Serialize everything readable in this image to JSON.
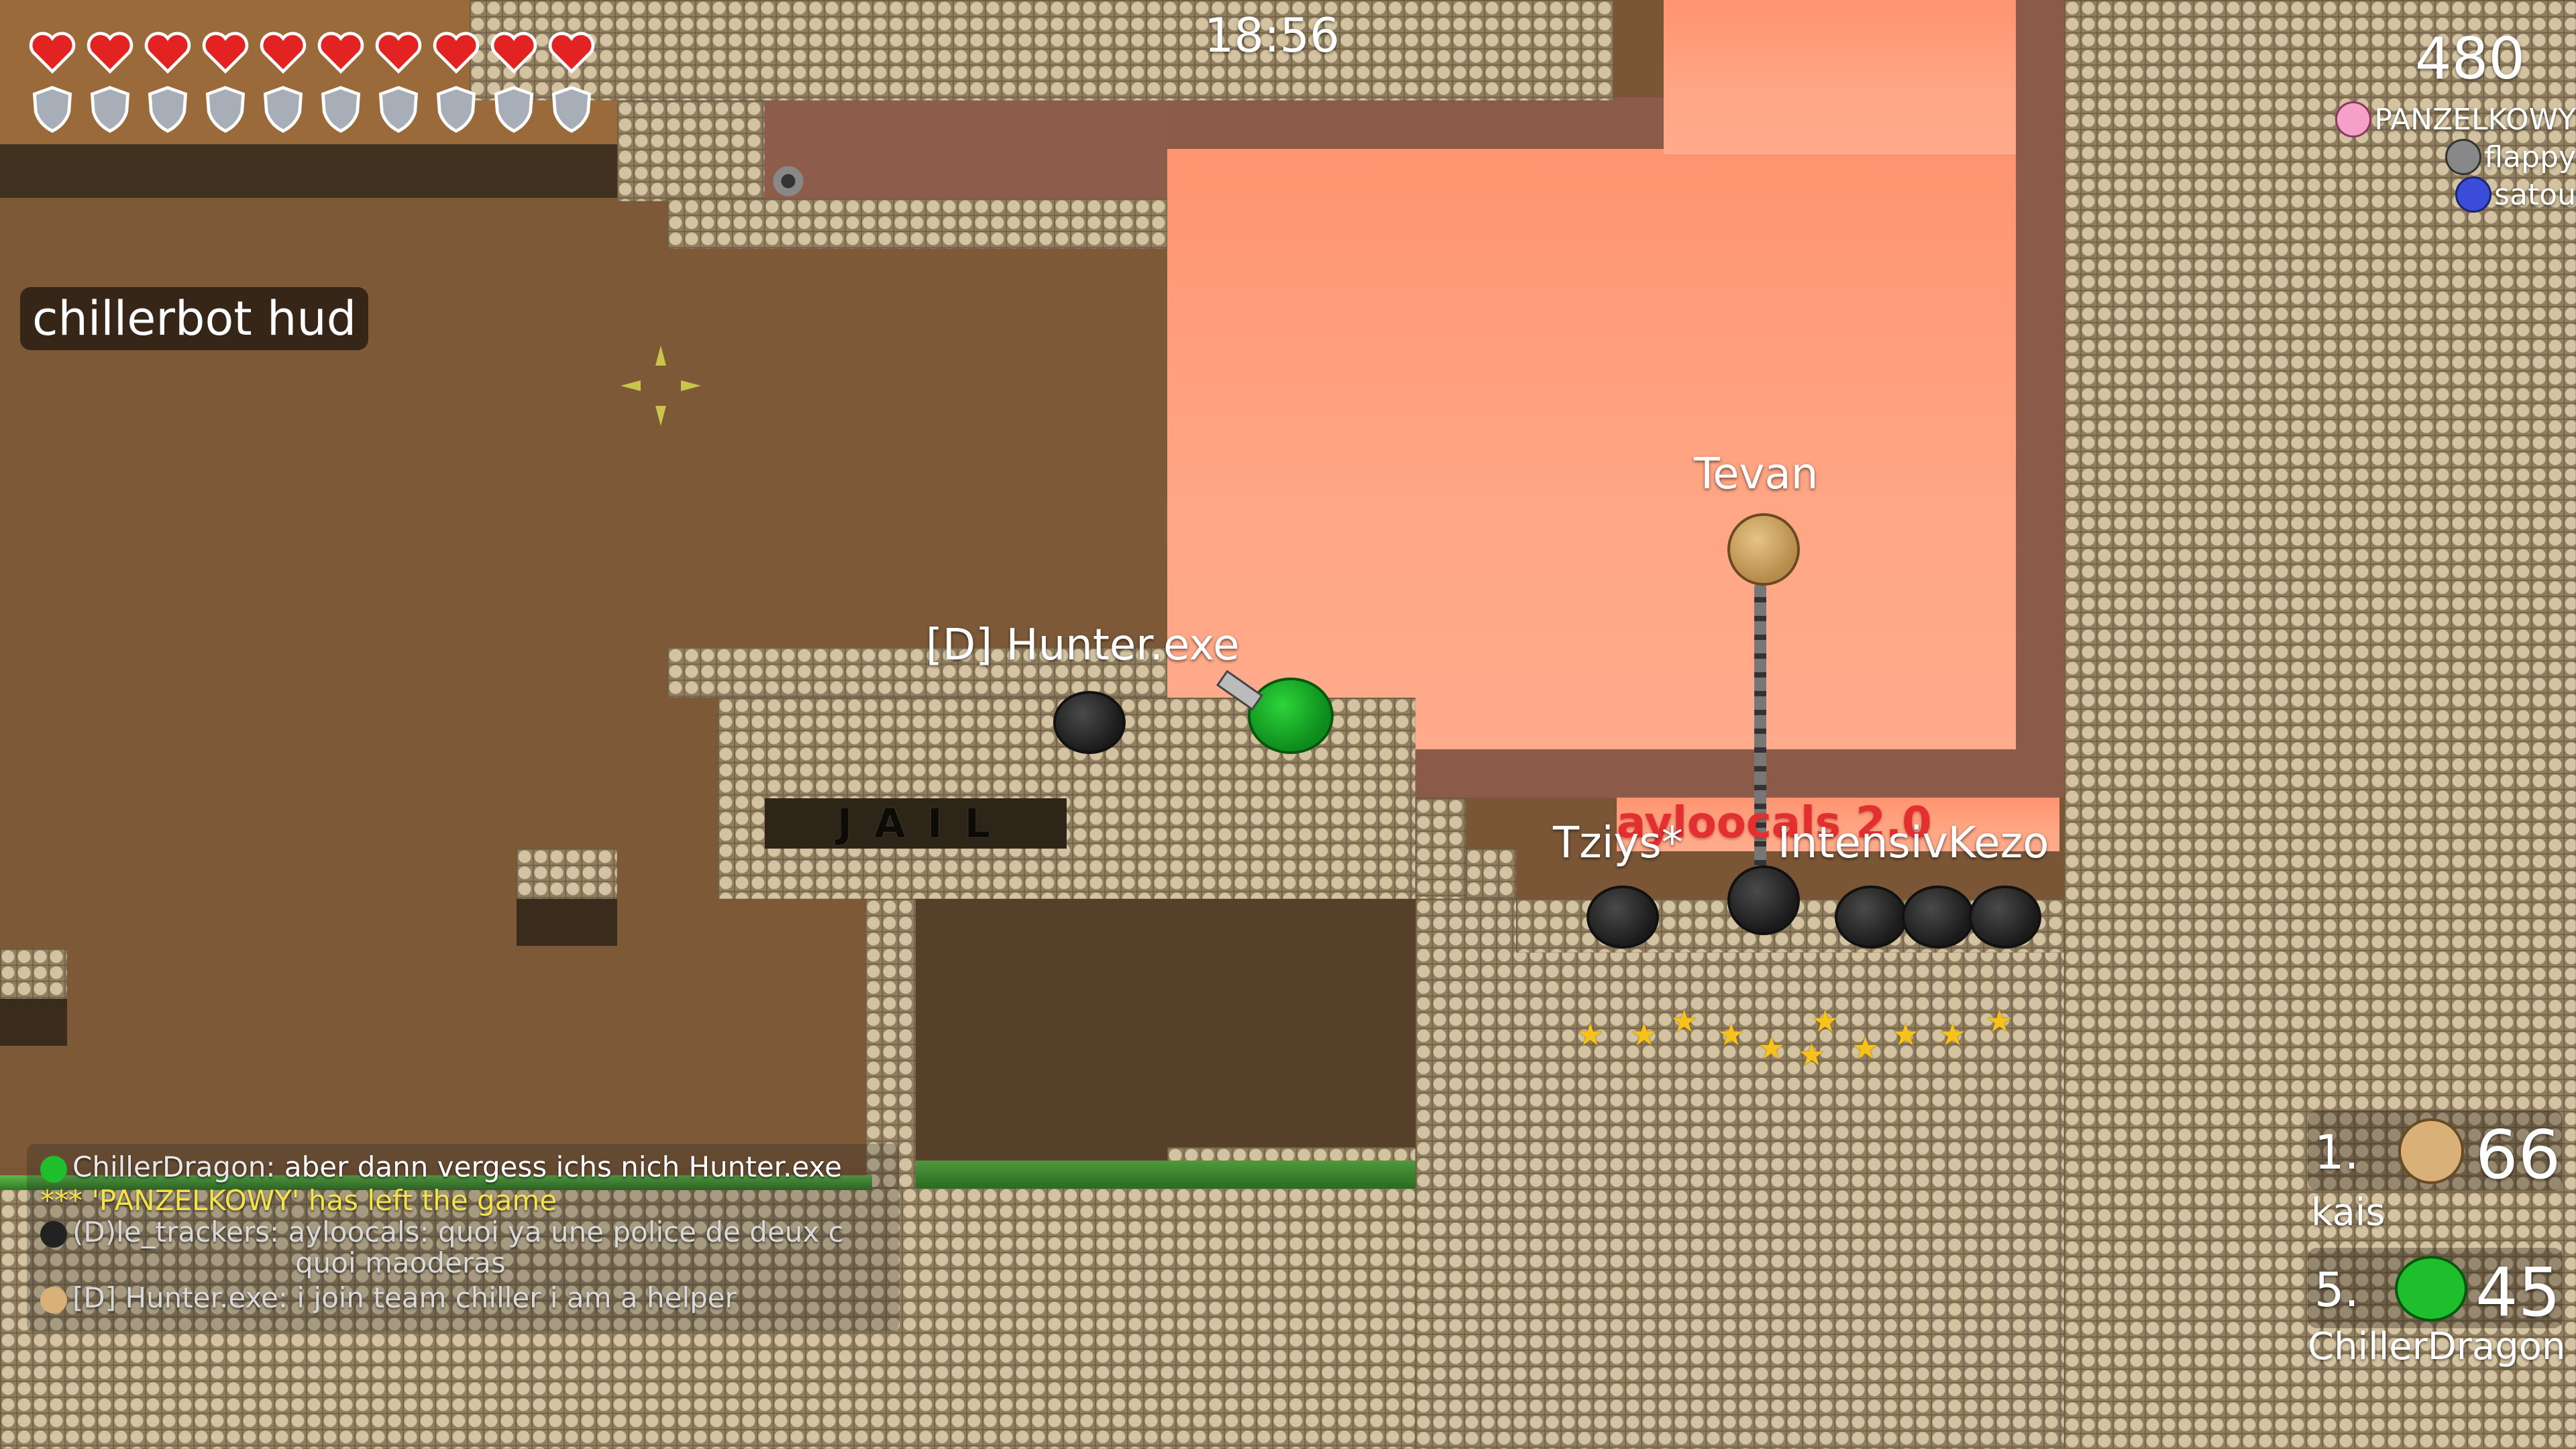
{
  "hud": {
    "clock": "18:56",
    "score": "480",
    "health": 10,
    "armor": 10,
    "client_tag": "chillerbot hud"
  },
  "spectators": [
    {
      "name": "PANZELKOWY",
      "skin": "pink-tee-icon"
    },
    {
      "name": "flappy",
      "skin": "gray-tee-icon"
    },
    {
      "name": "satou",
      "skin": "blue-tee-icon"
    }
  ],
  "players": {
    "hunter": "[D] Hunter.exe",
    "tevan": "Tevan",
    "tziys": "Tziys*",
    "intensive": "IntensivKezo",
    "ayloocals": "ayloocals 2.0"
  },
  "map": {
    "jail_sign": "J A I L"
  },
  "chat": [
    {
      "author": "ChillerDragon",
      "text": "aber dann vergess ichs nich Hunter.exe",
      "color": "#ffffff",
      "icon": "green-tee-icon"
    },
    {
      "author": "",
      "text": "*** 'PANZELKOWY' has left the game",
      "color": "#f5e34a",
      "icon": ""
    },
    {
      "author": "(D)le_trackers",
      "text": "ayloocals: quoi ya une police de deux c",
      "color": "#d8d8d8",
      "icon": "black-tee-icon"
    },
    {
      "author": "",
      "text": "quoi maoderas",
      "color": "#d8d8d8",
      "icon": ""
    },
    {
      "author": "[D] Hunter.exe",
      "text": "i join team chiller i am a helper",
      "color": "#d8d8d8",
      "icon": "tan-tee-icon"
    }
  ],
  "scoreboard": [
    {
      "rank": "1.",
      "score": "66",
      "name": "kais",
      "icon": "tan-tee-icon"
    },
    {
      "rank": "5.",
      "score": "45",
      "name": "ChillerDragon",
      "icon": "green-tee-icon"
    }
  ],
  "colors": {
    "sky": "#ff9a78",
    "dirt": "#7d5938",
    "tile": "#b3a283",
    "heart": "#e32222",
    "shield": "#a8aeb8",
    "chat_system": "#f5e34a"
  }
}
